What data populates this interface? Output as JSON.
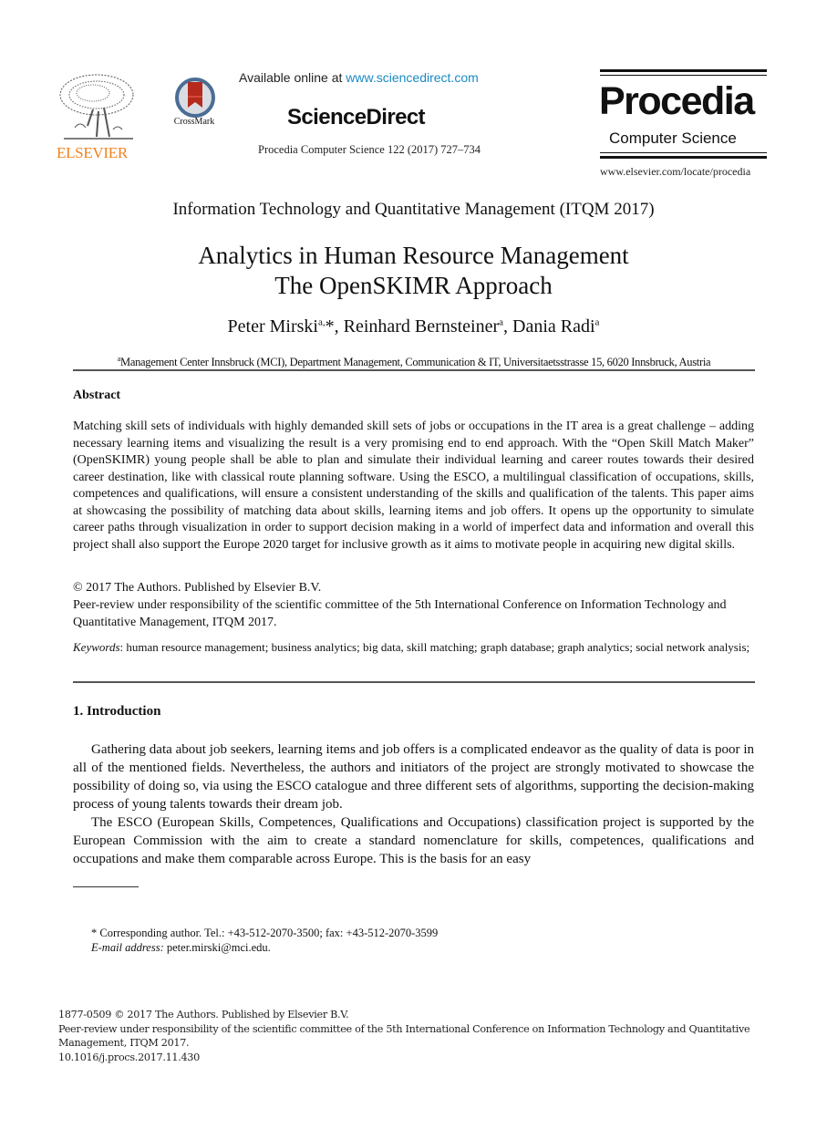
{
  "header": {
    "publisher_name": "ELSEVIER",
    "crossmark_label": "CrossMark",
    "available_prefix": "Available online at ",
    "available_link": "www.sciencedirect.com",
    "sciencedirect_logo": "ScienceDirect",
    "journal_ref": "Procedia Computer Science 122 (2017) 727–734",
    "procedia_title": "Procedia",
    "procedia_subtitle": "Computer Science",
    "procedia_url": "www.elsevier.com/locate/procedia"
  },
  "conference": "Information Technology and Quantitative Management (ITQM 2017)",
  "title": {
    "line1": "Analytics in Human Resource Management",
    "line2": "The OpenSKIMR Approach"
  },
  "authors": [
    {
      "name": "Peter Mirski",
      "sup": "a,",
      "mark": "*",
      "sep": ", "
    },
    {
      "name": "Reinhard Bernsteiner",
      "sup": "a",
      "mark": "",
      "sep": ", "
    },
    {
      "name": "Dania Radi",
      "sup": "a",
      "mark": "",
      "sep": ""
    }
  ],
  "affiliation": {
    "sup": "a",
    "text": "Management Center Innsbruck (MCI), Department Management, Communication & IT, Universitaetsstrasse 15, 6020 Innsbruck, Austria"
  },
  "abstract": {
    "heading": "Abstract",
    "body": "Matching skill sets of individuals with highly demanded skill sets of jobs or occupations in the IT area is a great challenge – adding necessary learning items and visualizing the result is a very promising end to end approach. With the “Open Skill Match Maker” (OpenSKIMR) young people shall be able to plan and simulate their individual learning and career routes towards their desired career destination, like with classical route planning software. Using the ESCO, a multilingual classification of occupations, skills, competences and qualifications, will ensure a consistent understanding of the skills and qualification of the talents. This paper aims at showcasing the possibility of matching data about skills, learning items and job offers. It opens up the opportunity to simulate career paths through visualization in order to support decision making in a world of imperfect data and information and overall this project shall also support the Europe 2020 target for inclusive growth as it aims to motivate people in acquiring new digital skills.",
    "copyright": "© 2017 The Authors. Published by Elsevier B.V.",
    "peer_review": "Peer-review under responsibility of the scientific committee of the 5th International Conference on Information Technology and Quantitative Management, ITQM 2017.",
    "keywords_label": "Keywords",
    "keywords": ": human resource management; business analytics; big data, skill matching; graph database; graph analytics; social network analysis;"
  },
  "introduction": {
    "heading": "1. Introduction",
    "paragraphs": [
      "Gathering data about job seekers, learning items and job offers is a complicated endeavor as the quality of data is poor in all of the mentioned fields. Nevertheless, the authors and initiators of the project are strongly motivated to showcase the possibility of doing so, via using the ESCO catalogue and three different sets of algorithms, supporting the decision-making process of young talents towards their dream job.",
      "The ESCO (European Skills, Competences, Qualifications and Occupations) classification project is supported by the European Commission with the aim to create a standard nomenclature for skills, competences, qualifications and occupations and make them comparable across Europe. This is the basis for an easy"
    ]
  },
  "footnote": {
    "corresponding": "* Corresponding author. Tel.: +43-512-2070-3500; fax: +43-512-2070-3599",
    "email_label": "E-mail address:",
    "email": " peter.mirski@mci.edu."
  },
  "bottom": {
    "issn": "1877-0509 © 2017 The Authors. Published by Elsevier B.V.",
    "peer_review": "Peer-review under responsibility of the scientific committee of the 5th International Conference on Information Technology and Quantitative Management, ITQM 2017.",
    "doi": "10.1016/j.procs.2017.11.430"
  }
}
